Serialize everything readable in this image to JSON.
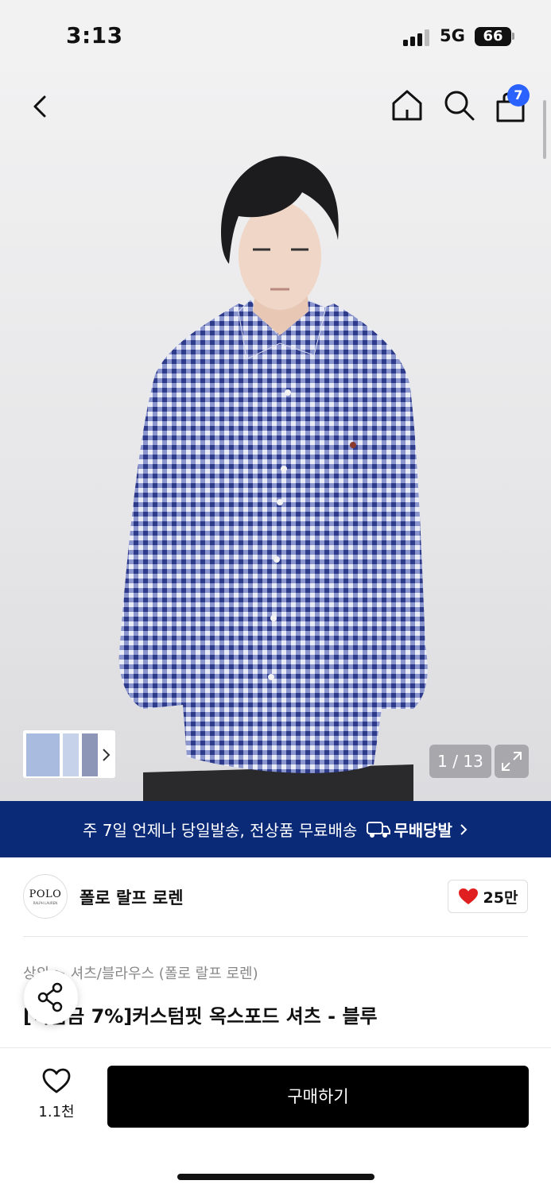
{
  "status_bar": {
    "time": "3:13",
    "network": "5G",
    "battery": "66"
  },
  "nav": {
    "cart_count": "7"
  },
  "gallery": {
    "counter": "1 / 13"
  },
  "promo": {
    "text": "주 7일 언제나 당일발송, 전상품 무료배송",
    "logo_text": "무배당발"
  },
  "brand": {
    "logo_line1": "POLO",
    "logo_line2": "RALPH LAUREN",
    "name": "폴로 랄프 로렌",
    "likes": "25만"
  },
  "product": {
    "breadcrumb": "상의 > 셔츠/블라우스 (폴로 랄프 로렌)",
    "title": "[적립금 7%]커스텀핏 옥스포드 셔츠 - 블루"
  },
  "bottom": {
    "wish_count": "1.1천",
    "buy_label": "구매하기"
  },
  "colors": {
    "banner": "#0a2a78",
    "badge": "#2962ff",
    "heart": "#e02020",
    "shirt": "#4654a8"
  }
}
